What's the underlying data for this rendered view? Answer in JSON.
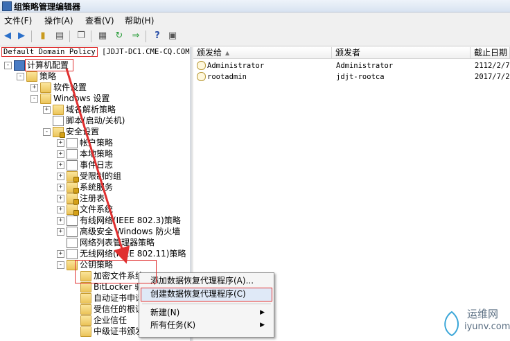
{
  "window": {
    "title": "组策略管理编辑器"
  },
  "menu": {
    "file": "文件(F)",
    "action": "操作(A)",
    "view": "查看(V)",
    "help": "帮助(H)"
  },
  "toolbar": [
    "back-icon",
    "forward-icon",
    "up-folder-icon",
    "show-tree-icon",
    "copy-icon",
    "export-list-icon",
    "refresh-icon",
    "properties-icon",
    "help-icon",
    "view-icon"
  ],
  "left": {
    "header_policy": "Default Domain Policy",
    "header_server": "[JDJT-DC1.CME-CQ.COM",
    "tree": [
      {
        "label": "计算机配置",
        "exp": "-",
        "icon": "comp"
      },
      {
        "label": "策略",
        "exp": "-",
        "icon": "folder"
      },
      {
        "label": "软件设置",
        "exp": "+",
        "icon": "folder"
      },
      {
        "label": "Windows 设置",
        "exp": "-",
        "icon": "folder"
      },
      {
        "label": "域名解析策略",
        "exp": "+",
        "icon": "folder"
      },
      {
        "label": "脚本(启动/关机)",
        "exp": "",
        "icon": "doc"
      },
      {
        "label": "安全设置",
        "exp": "-",
        "icon": "lock"
      },
      {
        "label": "帐户策略",
        "exp": "+",
        "icon": "doc"
      },
      {
        "label": "本地策略",
        "exp": "+",
        "icon": "doc"
      },
      {
        "label": "事件日志",
        "exp": "+",
        "icon": "doc"
      },
      {
        "label": "受限制的组",
        "exp": "+",
        "icon": "lock"
      },
      {
        "label": "系统服务",
        "exp": "+",
        "icon": "lock"
      },
      {
        "label": "注册表",
        "exp": "+",
        "icon": "lock"
      },
      {
        "label": "文件系统",
        "exp": "+",
        "icon": "lock"
      },
      {
        "label": "有线网络(IEEE 802.3)策略",
        "exp": "+",
        "icon": "doc"
      },
      {
        "label": "高级安全 Windows 防火墙",
        "exp": "+",
        "icon": "doc"
      },
      {
        "label": "网络列表管理器策略",
        "exp": "",
        "icon": "doc"
      },
      {
        "label": "无线网络(IEEE 802.11)策略",
        "exp": "+",
        "icon": "doc"
      },
      {
        "label": "公钥策略",
        "exp": "-",
        "icon": "folder"
      },
      {
        "label": "加密文件系统",
        "exp": "",
        "icon": "folder"
      },
      {
        "label": "BitLocker 驱",
        "exp": "",
        "icon": "folder"
      },
      {
        "label": "自动证书申请",
        "exp": "",
        "icon": "folder"
      },
      {
        "label": "受信任的根证书",
        "exp": "",
        "icon": "folder"
      },
      {
        "label": "企业信任",
        "exp": "",
        "icon": "folder"
      },
      {
        "label": "中级证书颁发",
        "exp": "",
        "icon": "folder"
      }
    ]
  },
  "right": {
    "columns": [
      "颁发给",
      "颁发者",
      "截止日期"
    ],
    "rows": [
      {
        "issued_to": "Administrator",
        "issued_by": "Administrator",
        "expires": "2112/2/7"
      },
      {
        "issued_to": "rootadmin",
        "issued_by": "jdjt-rootca",
        "expires": "2017/7/2"
      }
    ]
  },
  "context_menu": {
    "items": [
      "添加数据恢复代理程序(A)...",
      "创建数据恢复代理程序(C)",
      "新建(N)",
      "所有任务(K)"
    ]
  },
  "watermark": {
    "cn": "运维网",
    "en": "iyunv.com"
  }
}
